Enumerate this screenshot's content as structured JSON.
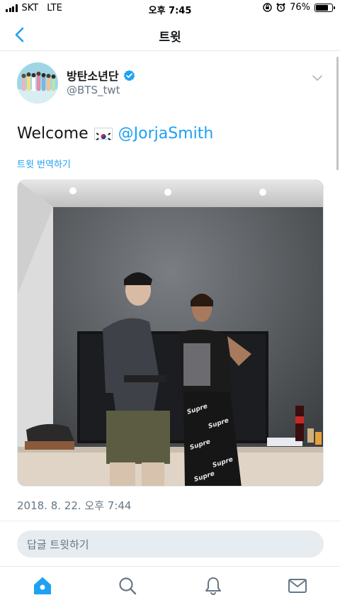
{
  "status": {
    "carrier": "SKT",
    "network": "LTE",
    "time": "오후 7:45",
    "battery": "76%",
    "battery_level": 0.76
  },
  "nav": {
    "title": "트윗"
  },
  "tweet": {
    "author_name": "방탄소년단",
    "handle": "@BTS_twt",
    "text_prefix": "Welcome",
    "mention": "@JorjaSmith",
    "translate_label": "트윗 번역하기",
    "timestamp": "2018. 8. 22. 오후 7:44"
  },
  "reply": {
    "placeholder": "답글 트윗하기"
  },
  "tabs": [
    {
      "icon": "home-icon"
    },
    {
      "icon": "search-icon"
    },
    {
      "icon": "bell-icon"
    },
    {
      "icon": "mail-icon"
    }
  ],
  "colors": {
    "accent": "#1da1f2",
    "secondary_text": "#657786",
    "verified": "#1da1f2"
  }
}
